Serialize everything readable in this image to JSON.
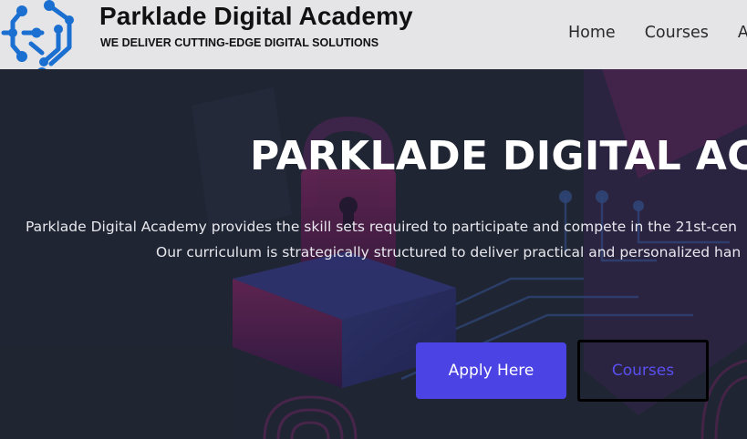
{
  "brand": {
    "title": "Parklade Digital Academy",
    "tagline": "WE DELIVER CUTTING-EDGE DIGITAL SOLUTIONS",
    "logo_icon": "circuit-network-logo",
    "logo_color": "#1a6fd1"
  },
  "nav": {
    "items": [
      {
        "label": "Home"
      },
      {
        "label": "Courses"
      },
      {
        "label": "A"
      }
    ]
  },
  "hero": {
    "title": "PARKLADE DIGITAL ACA",
    "line1": "Parklade Digital Academy provides the skill sets required to participate and compete in the 21st-cen",
    "line2": "Our curriculum is strategically structured to deliver practical and personalized han",
    "background_icon": "cyber-security-padlock-illustration"
  },
  "buttons": {
    "apply_label": "Apply Here",
    "courses_label": "Courses"
  },
  "colors": {
    "header_bg": "#e5e5e8",
    "hero_bg": "#222a38",
    "accent": "#4b43e3",
    "courses_text": "#5a4ff0"
  }
}
